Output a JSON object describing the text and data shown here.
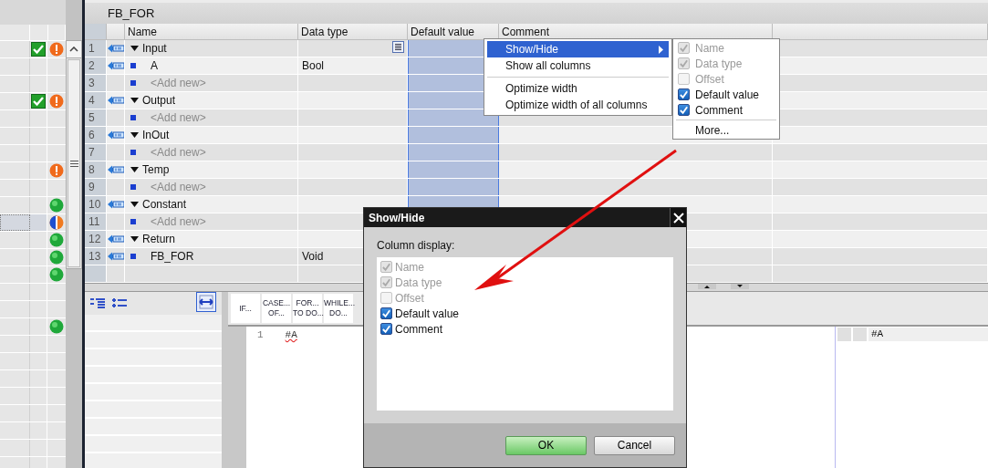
{
  "left_panel": {
    "rows": [
      {
        "check": true,
        "kind": "warning",
        "selected": false
      },
      {
        "check": false,
        "selected": false
      },
      {
        "check": false,
        "selected": false
      },
      {
        "check": true,
        "kind": "warning",
        "selected": false
      },
      {
        "check": false,
        "selected": false
      },
      {
        "check": false,
        "selected": false
      },
      {
        "check": false,
        "selected": false
      },
      {
        "check": false,
        "kind": "warning",
        "selected": false
      },
      {
        "check": false,
        "selected": false
      },
      {
        "check": false,
        "kind": "ok",
        "selected": false
      },
      {
        "check": false,
        "kind": "partial",
        "selected": true
      },
      {
        "check": false,
        "kind": "ok",
        "selected": false
      },
      {
        "check": false,
        "kind": "ok",
        "selected": false
      },
      {
        "check": false,
        "kind": "ok",
        "selected": false
      },
      {
        "check": false,
        "selected": false
      },
      {
        "check": false,
        "selected": false
      },
      {
        "check": false,
        "kind": "ok",
        "selected": false
      },
      {
        "check": false,
        "selected": false
      },
      {
        "check": false,
        "selected": false
      },
      {
        "check": false,
        "selected": false
      },
      {
        "check": false,
        "selected": false
      },
      {
        "check": false,
        "selected": false
      },
      {
        "check": false,
        "selected": false
      },
      {
        "check": false,
        "selected": false
      },
      {
        "check": false,
        "selected": false
      }
    ]
  },
  "editor": {
    "title": "FB_FOR",
    "columns": [
      {
        "label": "Name",
        "selected": false
      },
      {
        "label": "Data type",
        "selected": false
      },
      {
        "label": "Default value",
        "selected": true
      },
      {
        "label": "Comment",
        "selected": false
      }
    ],
    "rows": [
      {
        "number": "1",
        "kind": "section",
        "name": "Input"
      },
      {
        "number": "2",
        "kind": "item",
        "name": "A",
        "data_type": "Bool"
      },
      {
        "number": "3",
        "kind": "add",
        "name": "<Add new>"
      },
      {
        "number": "4",
        "kind": "section",
        "name": "Output"
      },
      {
        "number": "5",
        "kind": "add",
        "name": "<Add new>"
      },
      {
        "number": "6",
        "kind": "section",
        "name": "InOut"
      },
      {
        "number": "7",
        "kind": "add",
        "name": "<Add new>"
      },
      {
        "number": "8",
        "kind": "section",
        "name": "Temp"
      },
      {
        "number": "9",
        "kind": "add",
        "name": "<Add new>"
      },
      {
        "number": "10",
        "kind": "section",
        "name": "Constant"
      },
      {
        "number": "11",
        "kind": "add",
        "name": "<Add new>"
      },
      {
        "number": "12",
        "kind": "section",
        "name": "Return"
      },
      {
        "number": "13",
        "kind": "item",
        "name": "FB_FOR",
        "data_type": "Void"
      }
    ],
    "instructions": [
      {
        "label": "IF..."
      },
      {
        "label": "CASE...\nOF..."
      },
      {
        "label": "FOR...\nTO DO..."
      },
      {
        "label": "WHILE...\nDO..."
      }
    ],
    "code_lines": [
      {
        "number": "1",
        "text": "#A",
        "error": true
      }
    ],
    "watch_rows": [
      {
        "text": "#A"
      }
    ]
  },
  "context_menu": {
    "groups": [
      [
        {
          "label": "Show/Hide",
          "selected": true,
          "submenu": true
        },
        {
          "label": "Show all columns",
          "selected": false,
          "submenu": false
        }
      ],
      [
        {
          "label": "Optimize width",
          "selected": false,
          "submenu": false
        },
        {
          "label": "Optimize width of all columns",
          "selected": false,
          "submenu": false
        }
      ]
    ]
  },
  "submenu": {
    "items": [
      {
        "label": "Name",
        "checked": true,
        "disabled": true
      },
      {
        "label": "Data type",
        "checked": true,
        "disabled": true
      },
      {
        "label": "Offset",
        "checked": false,
        "disabled": true
      },
      {
        "label": "Default value",
        "checked": true,
        "disabled": false
      },
      {
        "label": "Comment",
        "checked": true,
        "disabled": false
      }
    ],
    "more": "More..."
  },
  "dialog": {
    "title": "Show/Hide",
    "label": "Column display:",
    "items": [
      {
        "label": "Name",
        "checked": true,
        "disabled": true
      },
      {
        "label": "Data type",
        "checked": true,
        "disabled": true
      },
      {
        "label": "Offset",
        "checked": false,
        "disabled": true
      },
      {
        "label": "Default value",
        "checked": true,
        "disabled": false
      },
      {
        "label": "Comment",
        "checked": true,
        "disabled": false
      }
    ],
    "buttons": [
      {
        "label": "OK",
        "kind": "primary"
      },
      {
        "label": "Cancel",
        "kind": "normal"
      }
    ]
  }
}
